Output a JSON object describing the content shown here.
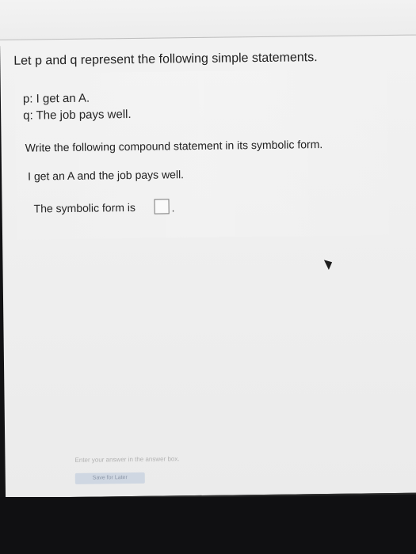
{
  "question": {
    "intro": "Let p and q represent the following simple statements.",
    "definitions": [
      "p: I get an A.",
      "q: The job pays well."
    ],
    "instruction": "Write the following compound statement in its symbolic form.",
    "compound_statement": "I get an A and the job pays well.",
    "answer_prefix": "The symbolic form is",
    "answer_value": "",
    "answer_suffix": "."
  },
  "footer": {
    "help_text": "Enter your answer in the answer box.",
    "save_label": "Save for Later"
  }
}
